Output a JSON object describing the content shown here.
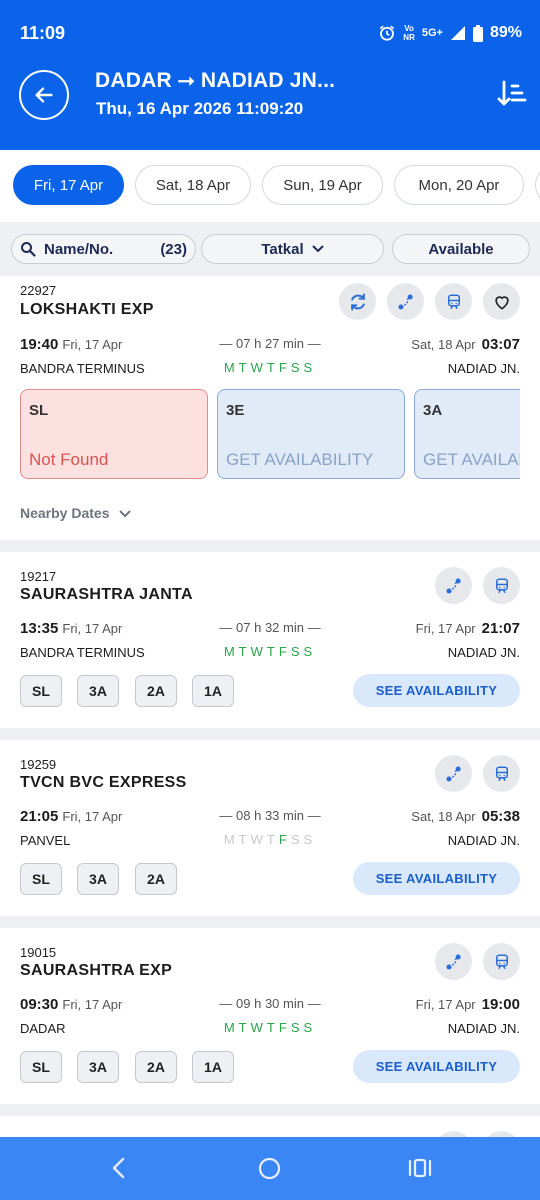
{
  "status": {
    "time": "11:09",
    "net_top": "Vo",
    "net_bottom": "NR",
    "net5g": "5G+",
    "battery": "89%"
  },
  "header": {
    "title": "DADAR ⭢ NADIAD JN...",
    "subtitle": "Thu, 16 Apr 2026 11:09:20"
  },
  "dates": [
    "Fri, 17 Apr",
    "Sat, 18 Apr",
    "Sun, 19 Apr",
    "Mon, 20 Apr"
  ],
  "filters": {
    "name_label": "Name/No.",
    "count": "(23)",
    "quota": "Tatkal",
    "availability": "Available"
  },
  "trains": [
    {
      "number": "22927",
      "name": "LOKSHAKTI EXP",
      "dep_time": "19:40",
      "dep_date": "Fri, 17 Apr",
      "duration": "— 07 h 27 min —",
      "arr_date": "Sat, 18 Apr",
      "arr_time": "03:07",
      "from": "BANDRA TERMINUS",
      "to": "NADIAD JN.",
      "classes": [
        {
          "code": "SL",
          "status": "Not Found"
        },
        {
          "code": "3E",
          "status": "GET AVAILABILITY"
        },
        {
          "code": "3A",
          "status": "GET AVAILABILITY"
        }
      ],
      "nearby": "Nearby Dates"
    },
    {
      "number": "19217",
      "name": "SAURASHTRA JANTA",
      "dep_time": "13:35",
      "dep_date": "Fri, 17 Apr",
      "duration": "— 07 h 32 min —",
      "arr_date": "Fri, 17 Apr",
      "arr_time": "21:07",
      "from": "BANDRA TERMINUS",
      "to": "NADIAD JN.",
      "classes": [
        "SL",
        "3A",
        "2A",
        "1A"
      ],
      "see": "SEE AVAILABILITY"
    },
    {
      "number": "19259",
      "name": "TVCN BVC EXPRESS",
      "dep_time": "21:05",
      "dep_date": "Fri, 17 Apr",
      "duration": "— 08 h 33 min —",
      "arr_date": "Sat, 18 Apr",
      "arr_time": "05:38",
      "from": "PANVEL",
      "to": "NADIAD JN.",
      "classes": [
        "SL",
        "3A",
        "2A"
      ],
      "see": "SEE AVAILABILITY"
    },
    {
      "number": "19015",
      "name": "SAURASHTRA EXP",
      "dep_time": "09:30",
      "dep_date": "Fri, 17 Apr",
      "duration": "— 09 h 30 min —",
      "arr_date": "Fri, 17 Apr",
      "arr_time": "19:00",
      "from": "DADAR",
      "to": "NADIAD JN.",
      "classes": [
        "SL",
        "3A",
        "2A",
        "1A"
      ],
      "see": "SEE AVAILABILITY"
    }
  ],
  "running_days": [
    "M",
    "T",
    "W",
    "T",
    "F",
    "S",
    "S"
  ],
  "colors": {
    "primary": "#0a63e8",
    "green": "#2aa34a",
    "red": "#d9534f"
  }
}
